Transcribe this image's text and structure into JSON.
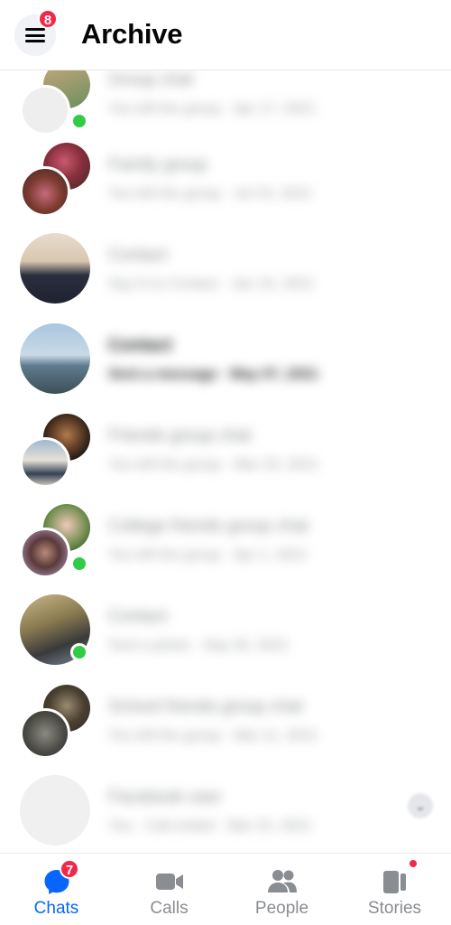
{
  "header": {
    "title": "Archive",
    "menu_badge": "8",
    "menu_icon": "hamburger-menu-icon"
  },
  "chats": [
    {
      "name": "Group chat",
      "preview": "You left the group · Apr 17, 2021",
      "online": true,
      "avatar": "pair"
    },
    {
      "name": "Family group",
      "preview": "You left the group · Jul 23, 2021",
      "online": false,
      "avatar": "pair"
    },
    {
      "name": "Contact",
      "preview": "Say hi to Contact · Jan 10, 2021",
      "online": false,
      "avatar": "single"
    },
    {
      "name": "Contact",
      "preview": "Sent a message · May 07, 2021",
      "online": false,
      "avatar": "single",
      "unread": true
    },
    {
      "name": "Friends group chat",
      "preview": "You left the group · Mar 29, 2021",
      "online": false,
      "avatar": "pair"
    },
    {
      "name": "College friends group chat",
      "preview": "You left the group · Apr 1, 2021",
      "online": true,
      "avatar": "pair"
    },
    {
      "name": "Contact",
      "preview": "Sent a photo · Sep 26, 2021",
      "online": true,
      "avatar": "single"
    },
    {
      "name": "School friends group chat",
      "preview": "You left the group · Mar 11, 2021",
      "online": false,
      "avatar": "pair"
    },
    {
      "name": "Facebook user",
      "preview": "You · Call ended · Mar 22, 2021",
      "online": false,
      "avatar": "placeholder"
    }
  ],
  "tabs": [
    {
      "label": "Chats",
      "icon": "chat-bubble-icon",
      "badge": "7",
      "active": true
    },
    {
      "label": "Calls",
      "icon": "video-camera-icon",
      "active": false
    },
    {
      "label": "People",
      "icon": "people-icon",
      "active": false
    },
    {
      "label": "Stories",
      "icon": "stories-icon",
      "active": false,
      "dot": true
    }
  ],
  "colors": {
    "accent": "#0866ff",
    "badge": "#f02849",
    "online": "#31cc46",
    "inactive_tab": "#8a8d91"
  }
}
